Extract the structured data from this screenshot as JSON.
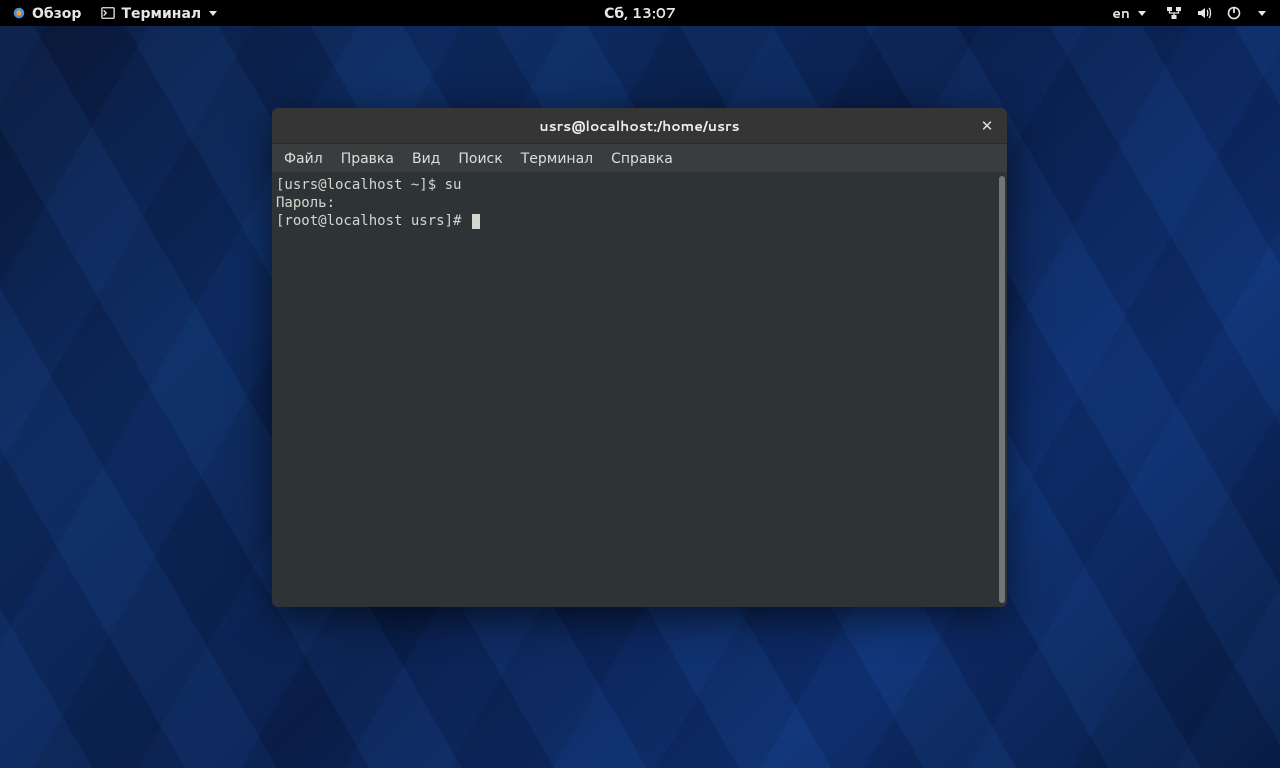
{
  "topbar": {
    "activities_label": "Обзор",
    "app_label": "Терминал",
    "clock": "Сб, 13:07",
    "input_lang": "en"
  },
  "window": {
    "title": "usrs@localhost:/home/usrs",
    "menus": {
      "file": "Файл",
      "edit": "Правка",
      "view": "Вид",
      "search": "Поиск",
      "terminal": "Терминал",
      "help": "Справка"
    }
  },
  "terminal": {
    "line1_prompt": "[usrs@localhost ~]$ ",
    "line1_cmd": "su",
    "line2": "Пароль:",
    "line3_prompt": "[root@localhost usrs]# "
  }
}
